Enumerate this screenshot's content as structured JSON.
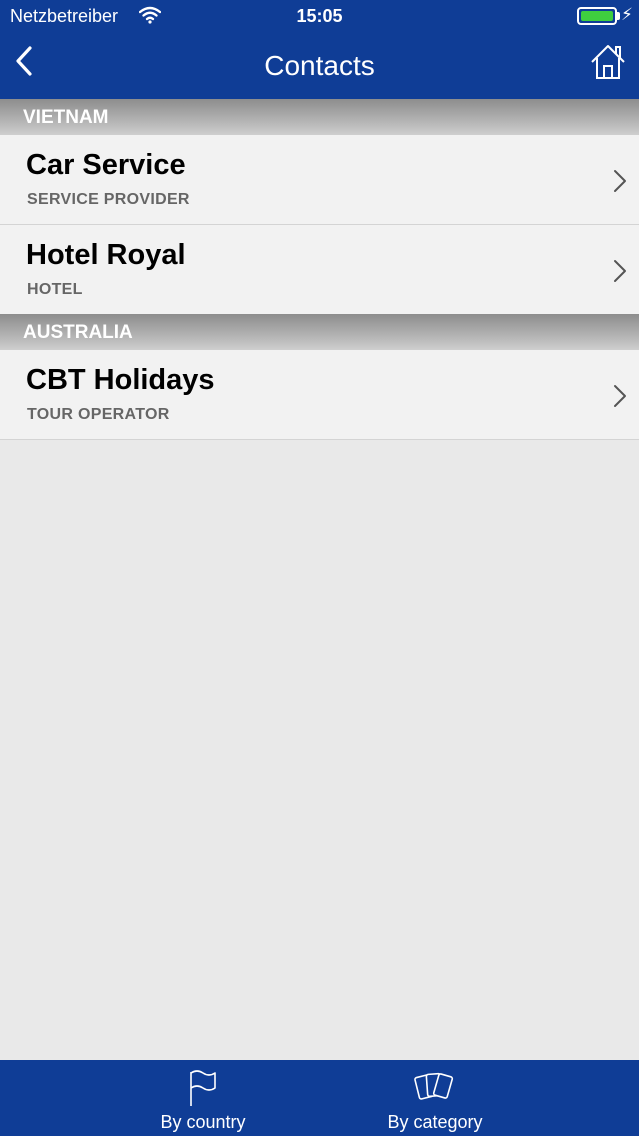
{
  "status_bar": {
    "carrier": "Netzbetreiber",
    "time": "15:05",
    "battery_level": 1.0
  },
  "nav": {
    "title": "Contacts",
    "back_icon": "chevron-left-icon",
    "home_icon": "home-icon"
  },
  "sections": [
    {
      "header": "VIETNAM",
      "rows": [
        {
          "title": "Car Service",
          "subtitle": "SERVICE PROVIDER"
        },
        {
          "title": "Hotel Royal",
          "subtitle": "HOTEL"
        }
      ]
    },
    {
      "header": "AUSTRALIA",
      "rows": [
        {
          "title": "CBT Holidays",
          "subtitle": "TOUR OPERATOR"
        }
      ]
    }
  ],
  "tabbar": {
    "tabs": [
      {
        "label": "By country",
        "icon": "flag-icon"
      },
      {
        "label": "By category",
        "icon": "cards-icon"
      }
    ]
  },
  "colors": {
    "brand": "#0f3d96",
    "battery": "#3fcf3f"
  }
}
